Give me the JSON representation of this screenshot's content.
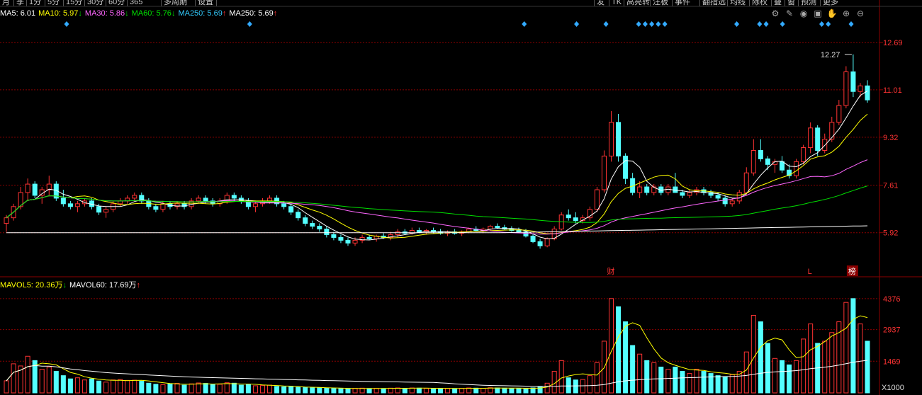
{
  "toolbar": {
    "left": [
      "月",
      "季",
      "1分",
      "5分",
      "15分",
      "30分",
      "60分",
      "365",
      "多周期",
      "设置"
    ],
    "right": [
      "发",
      "TK",
      "高亮转",
      "注板",
      "事件",
      "翻指选",
      "均线",
      "除权",
      "叠",
      "窗",
      "预测",
      "更多"
    ]
  },
  "ma_legend": [
    {
      "label": "MA5: 6.01",
      "arrow": "",
      "color": "#ffffff"
    },
    {
      "label": "MA10: 5.97",
      "arrow": "↓",
      "color": "#ffff00"
    },
    {
      "label": "MA30: 5.86",
      "arrow": "↓",
      "color": "#ff66ff"
    },
    {
      "label": "MA60: 5.76",
      "arrow": "↓",
      "color": "#00e000"
    },
    {
      "label": "MA250: 5.69",
      "arrow": "↑",
      "color": "#33ccff"
    },
    {
      "label": "MA250: 5.69",
      "arrow": "↑",
      "color": "#ffffff"
    }
  ],
  "vol_legend": [
    {
      "label": "MAVOL5: 20.36万",
      "arrow": "↓",
      "color": "#ffff00"
    },
    {
      "label": "MAVOL60: 17.69万",
      "arrow": "↑",
      "color": "#ffffff"
    }
  ],
  "tool_icons": [
    "settings-icon",
    "draw-pen-icon",
    "eye-icon",
    "portfolio-icon",
    "hand-icon",
    "zoom-in-icon",
    "zoom-out-icon"
  ],
  "price_axis": {
    "labels": [
      "12.69",
      "11.01",
      "9.32",
      "7.61",
      "5.92"
    ]
  },
  "volume_axis": {
    "labels": [
      "4376",
      "2937",
      "1469"
    ],
    "unit": "X1000"
  },
  "peak_label": "12.27",
  "markers": {
    "cai": "财",
    "L": "L",
    "bang": "榜"
  },
  "colors": {
    "up": "#ff3333",
    "down": "#54ffff",
    "grid": "#8b0000",
    "axis_text": "#ff3333"
  },
  "chart_data": {
    "type": "candlestick",
    "price_range": [
      4.5,
      13.2
    ],
    "volume_range": [
      0,
      4600
    ],
    "candles_ohlc": [
      [
        6.25,
        6.55,
        5.95,
        6.45
      ],
      [
        6.45,
        6.95,
        6.35,
        6.85
      ],
      [
        6.85,
        7.55,
        6.75,
        7.35
      ],
      [
        7.35,
        7.85,
        7.05,
        7.65
      ],
      [
        7.65,
        7.75,
        7.15,
        7.25
      ],
      [
        7.25,
        7.55,
        6.95,
        7.45
      ],
      [
        7.45,
        7.95,
        7.25,
        7.65
      ],
      [
        7.65,
        7.75,
        7.05,
        7.15
      ],
      [
        7.15,
        7.45,
        6.85,
        6.95
      ],
      [
        6.95,
        7.05,
        6.75,
        6.85
      ],
      [
        6.85,
        7.05,
        6.65,
        6.95
      ],
      [
        6.95,
        7.15,
        6.85,
        7.05
      ],
      [
        7.05,
        7.15,
        6.75,
        6.85
      ],
      [
        6.85,
        6.95,
        6.55,
        6.65
      ],
      [
        6.65,
        6.85,
        6.45,
        6.75
      ],
      [
        6.75,
        7.05,
        6.65,
        6.95
      ],
      [
        6.95,
        7.15,
        6.85,
        7.05
      ],
      [
        7.05,
        7.25,
        6.95,
        7.15
      ],
      [
        7.15,
        7.35,
        7.05,
        7.25
      ],
      [
        7.25,
        7.35,
        6.95,
        7.05
      ],
      [
        7.05,
        7.15,
        6.75,
        6.85
      ],
      [
        6.85,
        6.95,
        6.65,
        6.75
      ],
      [
        6.75,
        7.05,
        6.65,
        6.95
      ],
      [
        6.95,
        7.05,
        6.75,
        6.85
      ],
      [
        6.85,
        7.05,
        6.75,
        6.95
      ],
      [
        6.95,
        7.05,
        6.75,
        6.85
      ],
      [
        6.85,
        7.15,
        6.75,
        7.05
      ],
      [
        7.05,
        7.25,
        6.95,
        7.15
      ],
      [
        7.15,
        7.25,
        6.95,
        7.05
      ],
      [
        7.05,
        7.15,
        6.85,
        6.95
      ],
      [
        6.95,
        7.15,
        6.85,
        7.05
      ],
      [
        7.05,
        7.35,
        6.95,
        7.25
      ],
      [
        7.25,
        7.35,
        7.05,
        7.15
      ],
      [
        7.15,
        7.25,
        6.95,
        7.05
      ],
      [
        7.05,
        7.15,
        6.75,
        6.85
      ],
      [
        6.85,
        7.05,
        6.65,
        6.95
      ],
      [
        6.95,
        7.15,
        6.85,
        7.05
      ],
      [
        7.05,
        7.25,
        6.95,
        7.15
      ],
      [
        7.15,
        7.25,
        6.85,
        6.95
      ],
      [
        6.95,
        7.05,
        6.75,
        6.85
      ],
      [
        6.85,
        6.95,
        6.55,
        6.65
      ],
      [
        6.65,
        6.75,
        6.35,
        6.45
      ],
      [
        6.45,
        6.55,
        6.15,
        6.25
      ],
      [
        6.25,
        6.35,
        6.05,
        6.15
      ],
      [
        6.15,
        6.25,
        5.95,
        6.05
      ],
      [
        6.05,
        6.15,
        5.75,
        5.85
      ],
      [
        5.85,
        5.95,
        5.65,
        5.75
      ],
      [
        5.75,
        5.85,
        5.55,
        5.65
      ],
      [
        5.65,
        5.75,
        5.45,
        5.55
      ],
      [
        5.55,
        5.75,
        5.45,
        5.65
      ],
      [
        5.65,
        5.85,
        5.55,
        5.75
      ],
      [
        5.75,
        5.85,
        5.65,
        5.7
      ],
      [
        5.7,
        5.85,
        5.6,
        5.8
      ],
      [
        5.8,
        5.9,
        5.7,
        5.75
      ],
      [
        5.75,
        5.95,
        5.65,
        5.85
      ],
      [
        5.85,
        6.05,
        5.75,
        5.95
      ],
      [
        5.95,
        6.05,
        5.85,
        5.9
      ],
      [
        5.9,
        6.1,
        5.85,
        6.0
      ],
      [
        6.0,
        6.1,
        5.9,
        5.95
      ],
      [
        5.95,
        6.05,
        5.85,
        6.0
      ],
      [
        6.0,
        6.1,
        5.9,
        5.95
      ],
      [
        5.95,
        6.05,
        5.85,
        5.9
      ],
      [
        5.9,
        6.0,
        5.8,
        5.95
      ],
      [
        5.95,
        6.05,
        5.85,
        5.9
      ],
      [
        5.9,
        6.0,
        5.8,
        5.95
      ],
      [
        5.95,
        6.1,
        5.9,
        6.05
      ],
      [
        6.05,
        6.15,
        5.95,
        6.0
      ],
      [
        6.0,
        6.1,
        5.9,
        6.05
      ],
      [
        6.05,
        6.2,
        6.0,
        6.15
      ],
      [
        6.15,
        6.25,
        6.05,
        6.1
      ],
      [
        6.1,
        6.2,
        6.0,
        6.05
      ],
      [
        6.05,
        6.15,
        5.95,
        6.0
      ],
      [
        6.0,
        6.1,
        5.9,
        5.95
      ],
      [
        5.95,
        6.05,
        5.75,
        5.8
      ],
      [
        5.8,
        5.9,
        5.55,
        5.6
      ],
      [
        5.6,
        5.7,
        5.35,
        5.45
      ],
      [
        5.45,
        5.75,
        5.4,
        5.7
      ],
      [
        5.7,
        6.15,
        5.65,
        6.05
      ],
      [
        6.05,
        6.65,
        6.0,
        6.55
      ],
      [
        6.55,
        6.75,
        6.35,
        6.45
      ],
      [
        6.45,
        6.65,
        6.25,
        6.35
      ],
      [
        6.35,
        6.55,
        6.25,
        6.45
      ],
      [
        6.45,
        6.85,
        6.35,
        6.75
      ],
      [
        6.75,
        7.55,
        6.65,
        7.45
      ],
      [
        7.45,
        8.85,
        7.35,
        8.65
      ],
      [
        8.65,
        10.25,
        8.45,
        9.85
      ],
      [
        9.85,
        10.15,
        8.45,
        8.65
      ],
      [
        8.65,
        8.75,
        7.65,
        7.85
      ],
      [
        7.85,
        8.05,
        7.25,
        7.35
      ],
      [
        7.35,
        7.75,
        7.15,
        7.55
      ],
      [
        7.55,
        7.65,
        7.25,
        7.35
      ],
      [
        7.35,
        7.65,
        7.25,
        7.55
      ],
      [
        7.55,
        7.65,
        7.25,
        7.35
      ],
      [
        7.35,
        7.65,
        7.25,
        7.55
      ],
      [
        7.55,
        8.05,
        7.35,
        7.35
      ],
      [
        7.35,
        7.45,
        7.15,
        7.25
      ],
      [
        7.25,
        7.45,
        7.15,
        7.35
      ],
      [
        7.35,
        7.55,
        7.25,
        7.45
      ],
      [
        7.45,
        7.55,
        7.25,
        7.35
      ],
      [
        7.35,
        7.45,
        7.15,
        7.25
      ],
      [
        7.25,
        7.35,
        7.05,
        7.15
      ],
      [
        7.15,
        7.25,
        6.85,
        6.95
      ],
      [
        6.95,
        7.15,
        6.85,
        7.05
      ],
      [
        7.05,
        7.45,
        6.95,
        7.35
      ],
      [
        7.35,
        8.25,
        7.25,
        8.05
      ],
      [
        8.05,
        9.25,
        7.95,
        8.85
      ],
      [
        8.85,
        9.25,
        8.45,
        8.55
      ],
      [
        8.55,
        8.65,
        8.15,
        8.35
      ],
      [
        8.35,
        8.55,
        8.05,
        8.45
      ],
      [
        8.45,
        8.65,
        8.05,
        8.15
      ],
      [
        8.15,
        8.35,
        7.85,
        7.95
      ],
      [
        7.95,
        8.55,
        7.85,
        8.45
      ],
      [
        8.45,
        9.05,
        8.35,
        8.95
      ],
      [
        8.95,
        9.85,
        8.75,
        9.65
      ],
      [
        9.65,
        9.75,
        8.65,
        8.85
      ],
      [
        8.85,
        9.45,
        8.75,
        9.25
      ],
      [
        9.25,
        10.05,
        9.15,
        9.85
      ],
      [
        9.85,
        10.65,
        9.75,
        10.45
      ],
      [
        10.45,
        11.85,
        10.35,
        11.65
      ],
      [
        11.65,
        12.27,
        10.75,
        10.95
      ],
      [
        10.95,
        11.25,
        10.75,
        11.15
      ],
      [
        11.15,
        11.35,
        10.55,
        10.65
      ]
    ],
    "volume": [
      560,
      1350,
      1250,
      1700,
      1500,
      1100,
      1200,
      1000,
      800,
      650,
      700,
      600,
      650,
      550,
      500,
      600,
      620,
      580,
      590,
      540,
      450,
      400,
      380,
      420,
      440,
      360,
      420,
      460,
      440,
      380,
      400,
      470,
      450,
      360,
      380,
      330,
      340,
      360,
      300,
      280,
      280,
      260,
      250,
      240,
      230,
      220,
      210,
      200,
      190,
      210,
      220,
      200,
      210,
      200,
      220,
      230,
      210,
      230,
      220,
      210,
      200,
      210,
      205,
      200,
      210,
      230,
      220,
      210,
      240,
      230,
      220,
      210,
      200,
      200,
      230,
      270,
      450,
      1000,
      1500,
      700,
      600,
      620,
      800,
      1400,
      2400,
      4376,
      4000,
      3300,
      2200,
      1800,
      1500,
      1400,
      1200,
      1100,
      1200,
      1000,
      900,
      1100,
      1000,
      900,
      800,
      750,
      850,
      1000,
      1900,
      3600,
      3300,
      2300,
      1600,
      1500,
      1300,
      1500,
      2500,
      3200,
      2300,
      2400,
      2800,
      3300,
      4200,
      4376,
      3200,
      2400
    ],
    "ma_lines": [
      "MA5",
      "MA10",
      "MA30",
      "MA60",
      "MA250"
    ],
    "vol_ma_lines": [
      "MAVOL5",
      "MAVOL60"
    ]
  }
}
